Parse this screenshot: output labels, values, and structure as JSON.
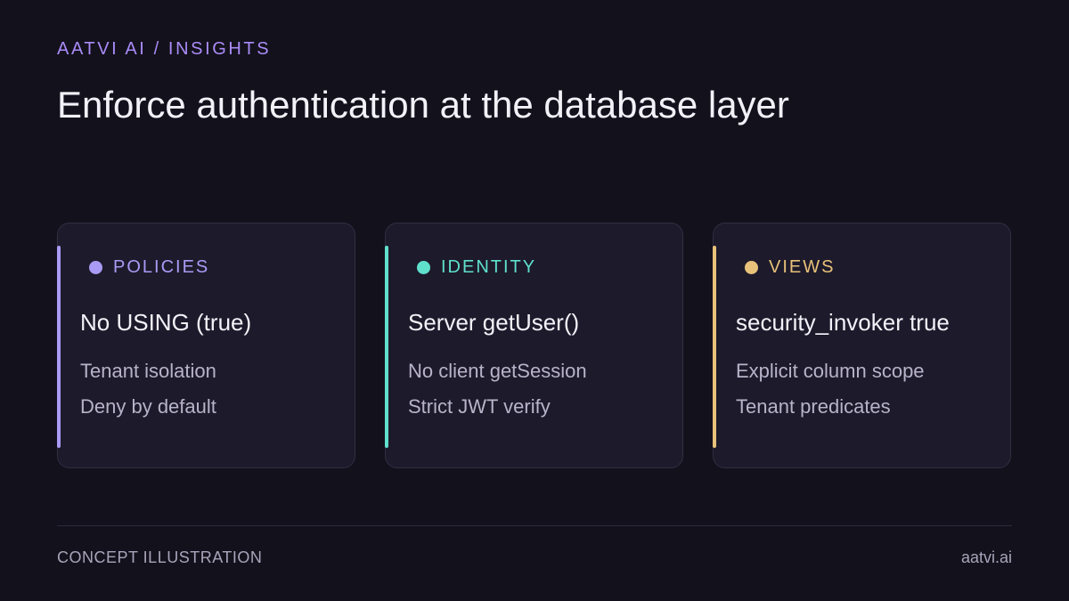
{
  "header": {
    "eyebrow": "AATVI AI / INSIGHTS",
    "title": "Enforce authentication at the database layer"
  },
  "cards": [
    {
      "tag": "POLICIES",
      "title": "No USING (true)",
      "lines": [
        "Tenant isolation",
        "Deny by default"
      ],
      "accent_color": "#a99bf5"
    },
    {
      "tag": "IDENTITY",
      "title": "Server getUser()",
      "lines": [
        "No client getSession",
        "Strict JWT verify"
      ],
      "accent_color": "#5fe0cc"
    },
    {
      "tag": "VIEWS",
      "title": "security_invoker true",
      "lines": [
        "Explicit column scope",
        "Tenant predicates"
      ],
      "accent_color": "#e8c27a"
    }
  ],
  "footer": {
    "left": "CONCEPT ILLUSTRATION",
    "right": "aatvi.ai"
  },
  "colors": {
    "background": "#13111c",
    "card_background": "#1d1a2b",
    "eyebrow": "#a98cf7"
  }
}
